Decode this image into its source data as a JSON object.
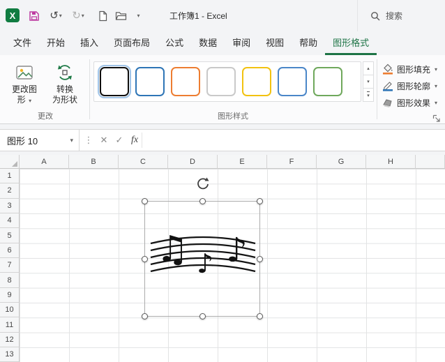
{
  "titlebar": {
    "title": "工作簿1 - Excel",
    "search_label": "搜索"
  },
  "glyphs": {
    "excel_logo": "X",
    "undo": "↺",
    "redo": "↻",
    "chevron_down": "▾",
    "dots": "⋮",
    "cancel": "✕",
    "check": "✓",
    "scroll_up": "▴",
    "scroll_down": "▾"
  },
  "tabs": [
    {
      "label": "文件"
    },
    {
      "label": "开始"
    },
    {
      "label": "插入"
    },
    {
      "label": "页面布局"
    },
    {
      "label": "公式"
    },
    {
      "label": "数据"
    },
    {
      "label": "审阅"
    },
    {
      "label": "视图"
    },
    {
      "label": "帮助"
    },
    {
      "label": "图形格式"
    }
  ],
  "ribbon": {
    "change_group": {
      "label": "更改",
      "buttons": [
        {
          "lines": [
            "更改图",
            "形"
          ],
          "has_menu": true
        },
        {
          "lines": [
            "转换",
            "为形状"
          ]
        }
      ]
    },
    "style_group": {
      "label": "图形样式",
      "swatches": [
        {
          "color": "#0f0f0f",
          "selected": true
        },
        {
          "color": "#2e75b6"
        },
        {
          "color": "#ed7d31"
        },
        {
          "color": "#c9c9c9"
        },
        {
          "color": "#f2c210"
        },
        {
          "color": "#4a86c8"
        },
        {
          "color": "#6fa85c"
        }
      ]
    },
    "tools": [
      {
        "label": "图形填充",
        "accent": "#ed7d31"
      },
      {
        "label": "图形轮廓",
        "accent": "#2e75b6"
      },
      {
        "label": "图形效果"
      }
    ]
  },
  "formula_bar": {
    "name_box": "图形 10",
    "fx_label": "fx",
    "input_value": ""
  },
  "grid": {
    "columns": [
      "A",
      "B",
      "C",
      "D",
      "E",
      "F",
      "G",
      "H"
    ],
    "rows": [
      "1",
      "2",
      "3",
      "4",
      "5",
      "6",
      "7",
      "8",
      "9",
      "10",
      "11",
      "12",
      "13"
    ]
  },
  "shape": {
    "notes": [
      "♫",
      "♪",
      "♪"
    ]
  }
}
